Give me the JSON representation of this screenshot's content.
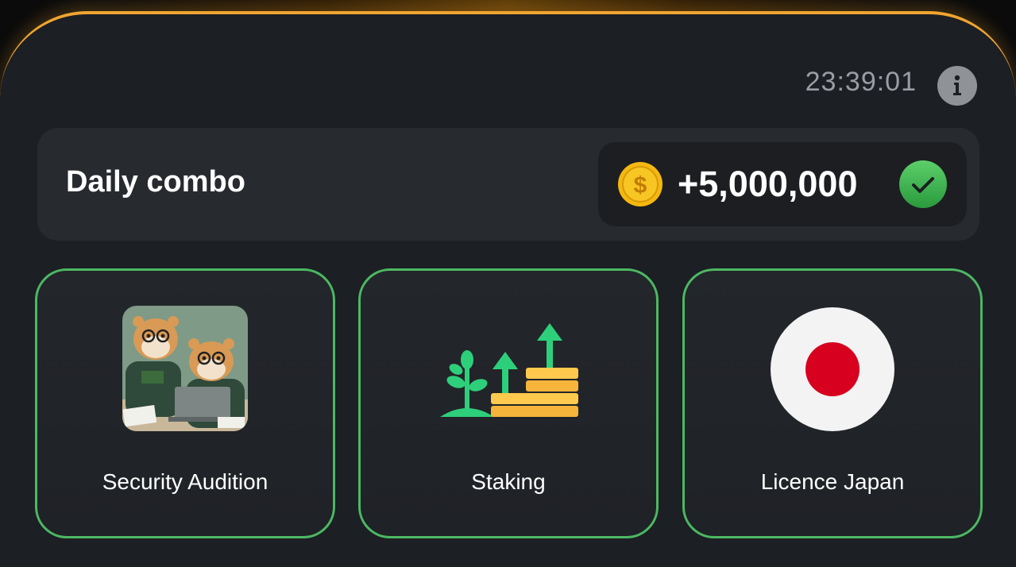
{
  "header": {
    "timer": "23:39:01",
    "info_icon": "info-icon"
  },
  "daily_combo": {
    "title": "Daily combo",
    "reward": "+5,000,000",
    "coin_icon": "coin-icon",
    "status_icon": "check-icon",
    "status": "completed"
  },
  "cards": [
    {
      "label": "Security Audition",
      "image": "hamsters-laptop-image"
    },
    {
      "label": "Staking",
      "image": "staking-growth-icon"
    },
    {
      "label": "Licence Japan",
      "image": "japan-flag-icon"
    }
  ],
  "colors": {
    "accent": "#f0a531",
    "card_border": "#4cb862",
    "check_green": "#3db24f",
    "coin_gold": "#f5b80f",
    "japan_red": "#d7001f"
  }
}
